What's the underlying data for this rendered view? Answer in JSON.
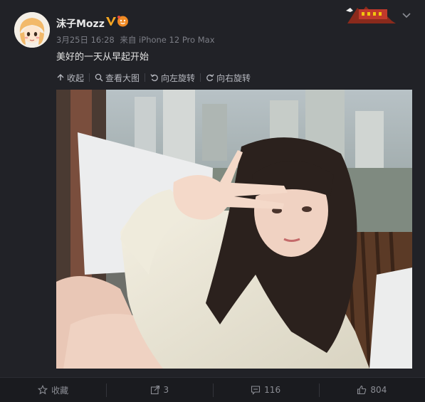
{
  "post": {
    "username": "沫子Mozz",
    "date": "3月25日 16:28",
    "source": "来自 iPhone 12 Pro Max",
    "text": "美好的一天从早起开始"
  },
  "toolbar": {
    "collapse": "收起",
    "view_large": "查看大图",
    "rotate_left": "向左旋转",
    "rotate_right": "向右旋转"
  },
  "actions": {
    "favorite": "收藏",
    "repost_count": "3",
    "comment_count": "116",
    "like_count": "804"
  },
  "colors": {
    "background": "#212227",
    "verified": "#f5a623",
    "text_muted": "#7c7e86"
  }
}
